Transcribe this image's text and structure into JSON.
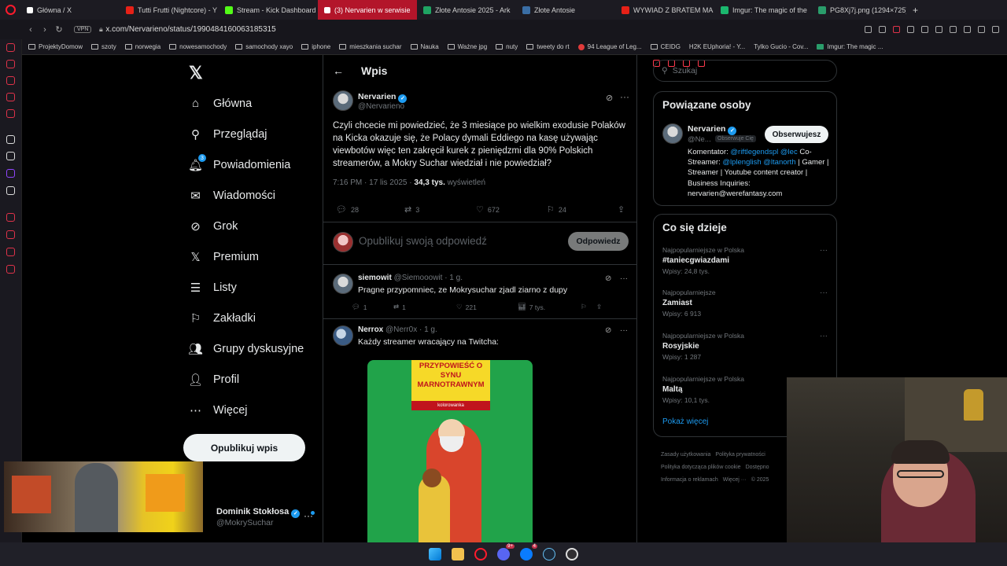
{
  "browser": {
    "tabs": [
      {
        "label": "Główna / X",
        "icon": "x-icon",
        "active": false
      },
      {
        "label": "Tutti Frutti (Nightcore) - Y",
        "icon": "youtube-icon",
        "active": false
      },
      {
        "label": "Stream - Kick Dashboard",
        "icon": "kick-icon",
        "active": false
      },
      {
        "label": "(3) Nervarien w serwisie",
        "icon": "x-icon",
        "active": true
      },
      {
        "label": "Złote Antosie 2025 - Ark",
        "icon": "sheets-icon",
        "active": false
      },
      {
        "label": "Złote Antosie",
        "icon": "site-icon",
        "active": false
      },
      {
        "label": "WYWIAD Z BRATEM MA",
        "icon": "youtube-icon",
        "active": false
      },
      {
        "label": "Imgur: The magic of the",
        "icon": "imgur-icon",
        "active": false
      },
      {
        "label": "PG8Xj7j.png (1294×725)",
        "icon": "image-icon",
        "active": false
      }
    ],
    "url": "x.com/Nervarieno/status/1990484160063185315",
    "vpn_label": "VPN",
    "bookmarks": [
      "ProjektyDomow",
      "szoty",
      "norwegia",
      "nowesamochody",
      "samochody xayo",
      "iphone",
      "mieszkania suchar",
      "Nauka",
      "Ważne jpg",
      "nuty",
      "tweety do rt",
      "94 League of Leg...",
      "CEIDG",
      "H2K EUphoria! - Y...",
      "Tylko Gucio - Cov...",
      "Imgur: The magic ..."
    ]
  },
  "sidebar": {
    "items": [
      {
        "label": "Główna",
        "icon": "home-icon"
      },
      {
        "label": "Przeglądaj",
        "icon": "search-icon"
      },
      {
        "label": "Powiadomienia",
        "icon": "bell-icon",
        "badge": "3"
      },
      {
        "label": "Wiadomości",
        "icon": "mail-icon"
      },
      {
        "label": "Grok",
        "icon": "grok-icon"
      },
      {
        "label": "Premium",
        "icon": "x-premium-icon"
      },
      {
        "label": "Listy",
        "icon": "list-icon"
      },
      {
        "label": "Zakładki",
        "icon": "bookmark-icon"
      },
      {
        "label": "Grupy dyskusyjne",
        "icon": "people-icon"
      },
      {
        "label": "Profil",
        "icon": "profile-icon"
      },
      {
        "label": "Więcej",
        "icon": "more-circle-icon"
      }
    ],
    "post_button": "Opublikuj wpis",
    "account": {
      "name": "Dominik Stokłosa",
      "handle": "@MokrySuchar"
    }
  },
  "main": {
    "header_title": "Wpis",
    "post": {
      "author_name": "Nervarien",
      "author_handle": "@Nervarieno",
      "text": "Czyli chcecie mi powiedzieć, że 3 miesiące po wielkim exodusie Polaków na Kicka okazuje się, że Polacy dymali Eddiego na kasę używając viewbotów więc ten zakręcił kurek z pieniędzmi dla 90% Polskich streamerów, a Mokry Suchar wiedział i nie powiedział?",
      "time": "7:16 PM · 17 lis 2025 · ",
      "views": "34,3 tys.",
      "views_label": " wyświetleń",
      "replies": "28",
      "reposts": "3",
      "likes": "672",
      "bookmarks": "24"
    },
    "reply_placeholder": "Opublikuj swoją odpowiedź",
    "reply_button": "Odpowiedz",
    "replies": [
      {
        "name": "siemowit",
        "handle": "@Siemooowit · 1 g.",
        "text": "Pragne przypomniec, ze Mokrysuchar zjadl ziarno z dupy",
        "replies": "1",
        "reposts": "1",
        "likes": "221",
        "views": "7 tys."
      },
      {
        "name": "Nerrox",
        "handle": "@Nerr0x · 1 g.",
        "text": "Każdy streamer wracający na Twitcha:",
        "image_title": "PRZYPOWIEŚĆ O SYNU MARNOTRAWNYM",
        "image_subtitle": "kolorowanka"
      }
    ]
  },
  "right": {
    "search_placeholder": "Szukaj",
    "related": {
      "title": "Powiązane osoby",
      "name": "Nervarien",
      "handle": "@Ne...",
      "follows_you": "Obserwuje Cię",
      "follow_button": "Obserwujesz",
      "bio_prefix": "Komentator: ",
      "bio_link1": "@riftlegendspl",
      "bio_mid": " ",
      "bio_link2": "@lec",
      "bio_after": " Co-Streamer: ",
      "bio_link3": "@lplenglish",
      "bio_sp": " ",
      "bio_link4": "@ltanorth",
      "bio_rest": " | Gamer | Streamer | Youtube content creator | Business Inquiries: nervarien@werefantasy.com"
    },
    "trends": {
      "title": "Co się dzieje",
      "items": [
        {
          "context": "Najpopularniejsze w Polska",
          "title": "#taniecgwiazdami",
          "count": "Wpisy: 24,8 tys."
        },
        {
          "context": "Najpopularniejsze",
          "title": "Zamiast",
          "count": "Wpisy: 6 913"
        },
        {
          "context": "Najpopularniejsze w Polska",
          "title": "Rosyjskie",
          "count": "Wpisy: 1 287"
        },
        {
          "context": "Najpopularniejsze w Polska",
          "title": "Maltą",
          "count": "Wpisy: 10,1 tys."
        }
      ],
      "show_more": "Pokaż więcej"
    },
    "footer": [
      "Zasady użytkowania",
      "Polityka prywatności",
      "Polityka dotycząca plików cookie",
      "Dostępno",
      "Informacja o reklamach",
      "Więcej ···",
      "© 2025"
    ]
  },
  "taskbar": {
    "icons": [
      "windows-start-icon",
      "file-explorer-icon",
      "opera-icon",
      "discord-icon",
      "messenger-icon",
      "steam-icon",
      "obs-icon"
    ],
    "badges": {
      "discord": "9+",
      "messenger": "4"
    }
  },
  "colors": {
    "accent": "#1d9bf0",
    "active_tab": "#b3152a",
    "background": "#000000",
    "border": "#2f3336"
  }
}
